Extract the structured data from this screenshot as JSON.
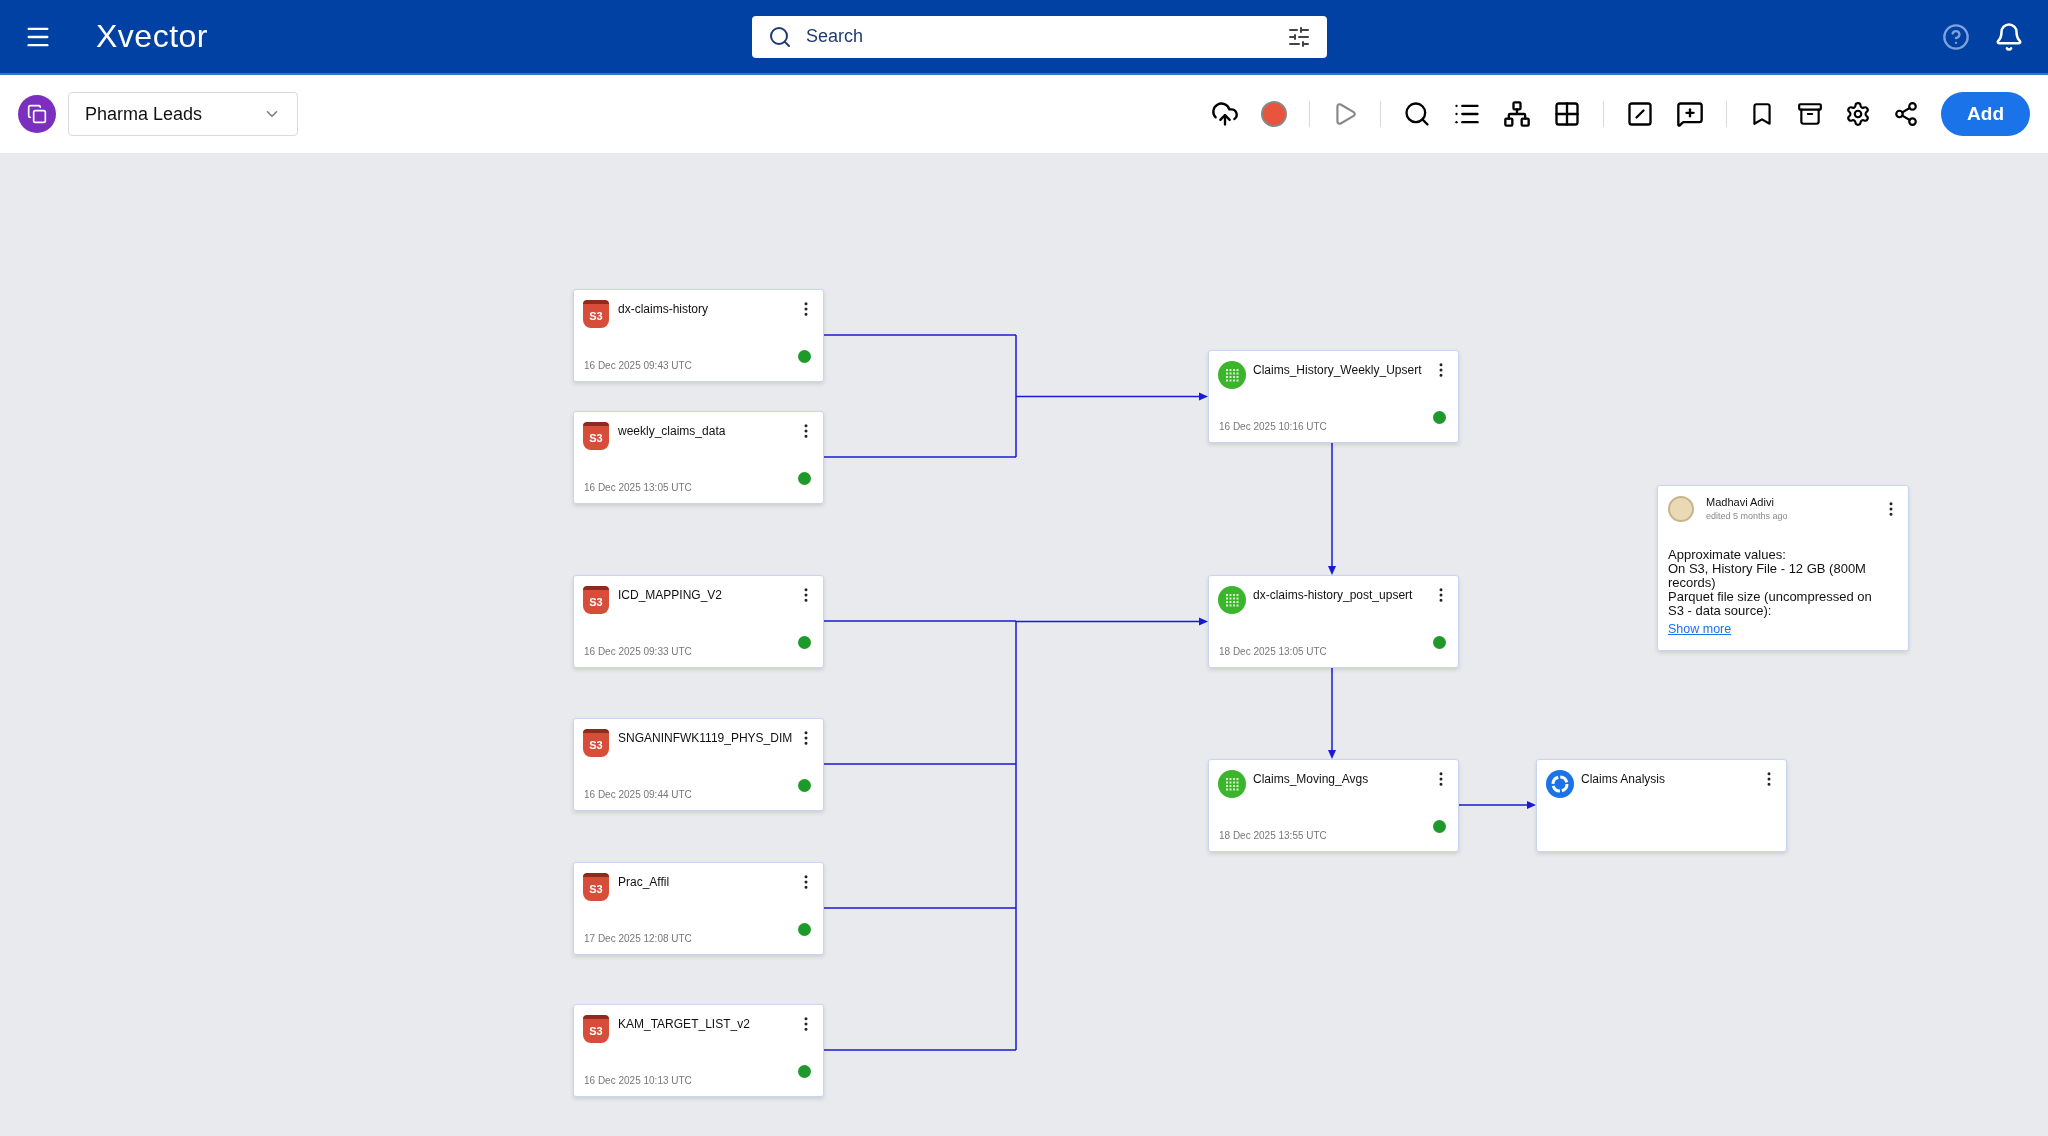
{
  "nav": {
    "brand": "Xvector",
    "search": {
      "placeholder": "Search"
    }
  },
  "toolbar": {
    "workspace": "Pharma Leads",
    "add_button": "Add"
  },
  "sources": [
    {
      "nodes": [
        {
          "kind": "s3",
          "badge": "S3",
          "name": "dx-claims-history",
          "time": "16 Dec 2025 09:43 UTC",
          "color": "#1e9a2b"
        },
        {
          "kind": "s3",
          "badge": "S3",
          "name": "weekly_claims_data",
          "time": "16 Dec 2025 13:05 UTC",
          "color": "#1e9a2b"
        }
      ]
    },
    {
      "nodes": [
        {
          "kind": "s3",
          "badge": "S3",
          "name": "ICD_MAPPING_V2",
          "time": "16 Dec 2025 09:33 UTC",
          "color": "#1e9a2b"
        },
        {
          "kind": "s3",
          "badge": "S3",
          "name": "SNGANINFWK1119_PHYS_DIM",
          "time": "16 Dec 2025 09:44 UTC",
          "color": "#1e9a2b"
        },
        {
          "kind": "s3",
          "badge": "S3",
          "name": "Prac_Affil",
          "time": "17 Dec 2025 12:08 UTC",
          "color": "#1e9a2b"
        },
        {
          "kind": "s3",
          "badge": "S3",
          "name": "KAM_TARGET_LIST_v2",
          "time": "16 Dec 2025 10:13 UTC",
          "color": "#1e9a2b"
        }
      ]
    }
  ],
  "transforms": [
    {
      "kind": "dataset",
      "name": "Claims_History_Weekly_Upsert",
      "time": "16 Dec 2025 10:16 UTC",
      "color": "#1e9a2b"
    },
    {
      "kind": "dataset",
      "name": "dx-claims-history_post_upsert",
      "time": "18 Dec 2025 13:05 UTC",
      "color": "#1e9a2b"
    },
    {
      "kind": "dataset",
      "name": "Claims_Moving_Avgs",
      "time": "18 Dec 2025 13:55 UTC",
      "color": "#1e9a2b"
    }
  ],
  "analysis": {
    "kind": "analysis",
    "name": "Claims Analysis"
  },
  "note": {
    "author": "Madhavi Adivi",
    "edited": "edited 5 months ago",
    "lines": [
      "Approximate values:",
      "On S3, History File - 12 GB (800M records)",
      "Parquet file size (uncompressed on S3 - data source):"
    ],
    "link": "Show more"
  }
}
